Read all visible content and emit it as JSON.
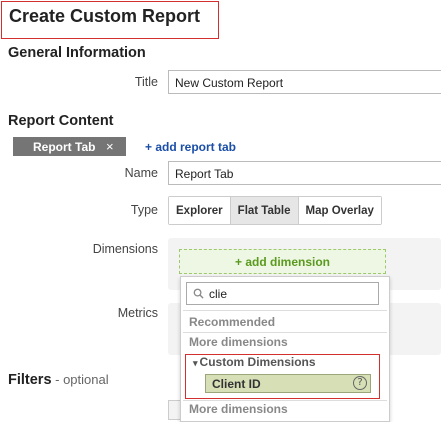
{
  "page": {
    "title": "Create Custom Report"
  },
  "general": {
    "heading": "General Information",
    "title_label": "Title",
    "title_value": "New Custom Report"
  },
  "content": {
    "heading": "Report Content",
    "tab_label": "Report Tab",
    "tab_close": "×",
    "add_tab": "+ add report tab",
    "name_label": "Name",
    "name_value": "Report Tab",
    "type_label": "Type",
    "types": [
      "Explorer",
      "Flat Table",
      "Map Overlay"
    ],
    "selected_type": "Flat Table",
    "dimensions_label": "Dimensions",
    "add_dimension": "+ add dimension",
    "metrics_label": "Metrics"
  },
  "filters": {
    "label": "Filters",
    "optional": " - optional"
  },
  "dropdown": {
    "search_value": "clie",
    "recommended": "Recommended",
    "more_dimensions_1": "More dimensions",
    "custom_dimensions": "Custom Dimensions",
    "expand_icon": "▾",
    "client_id": "Client ID",
    "help_glyph": "?",
    "more_dimensions_2": "More dimensions"
  },
  "colors": {
    "highlight_border": "#d32f2f",
    "add_dimension_green": "#5a9a1e",
    "link_blue": "#1a4ea8",
    "selected_row": "#d6dfb6"
  }
}
